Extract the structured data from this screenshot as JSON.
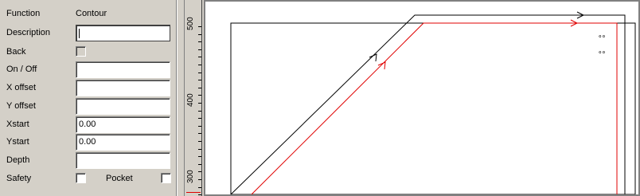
{
  "panel": {
    "header": {
      "label": "Function",
      "value": "Contour"
    },
    "description": {
      "label": "Description",
      "value": ""
    },
    "back": {
      "label": "Back"
    },
    "on_off": {
      "label": "On / Off",
      "value": ""
    },
    "x_offset": {
      "label": "X offset",
      "value": ""
    },
    "y_offset": {
      "label": "Y offset",
      "value": ""
    },
    "xstart": {
      "label": "Xstart",
      "value": "0.00"
    },
    "ystart": {
      "label": "Ystart",
      "value": "0.00"
    },
    "depth": {
      "label": "Depth",
      "value": ""
    },
    "safety": {
      "label": "Safety"
    },
    "pocket": {
      "label": "Pocket"
    }
  },
  "ruler": {
    "labels": [
      "500",
      "400",
      "300"
    ]
  },
  "canvas": {
    "markers": [
      "∘∘",
      "∘∘"
    ]
  },
  "colors": {
    "toolpath": "#000000",
    "contour": "#e00000",
    "panel_bg": "#d4d0c8"
  }
}
